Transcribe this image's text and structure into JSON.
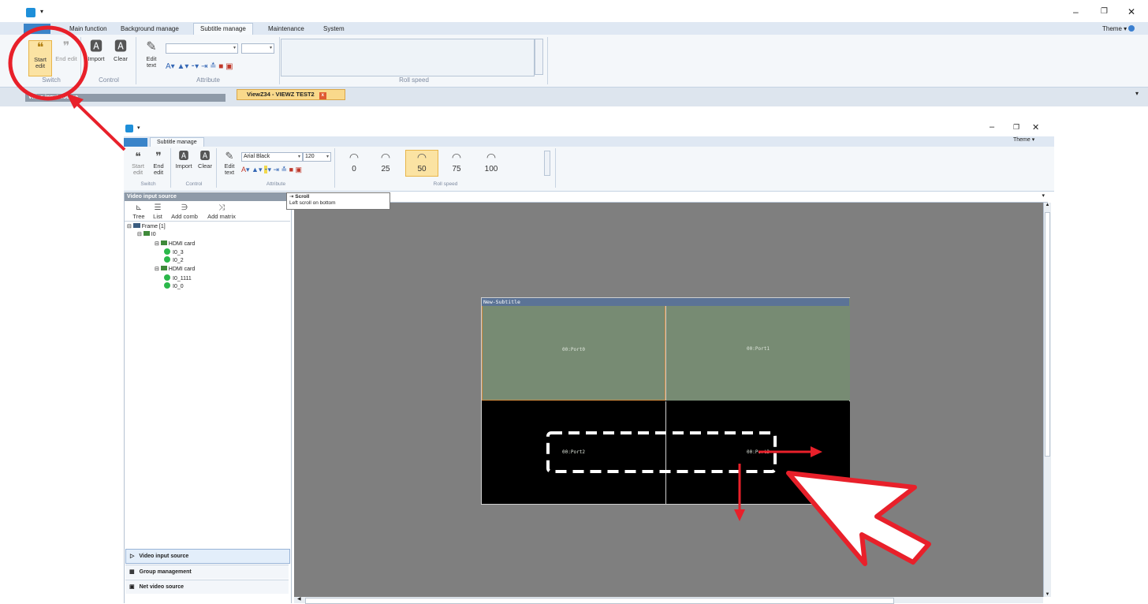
{
  "top_window": {
    "title_bar": {
      "minimize": "–",
      "restore": "❐",
      "close": "✕"
    },
    "tabs": [
      "Main function",
      "Background manage",
      "Subtitle manage",
      "Maintenance",
      "System"
    ],
    "active_tab": "Subtitle manage",
    "theme_label": "Theme",
    "ribbon": {
      "switch": {
        "start_edit": "Start edit",
        "end_edit": "End edit",
        "group_label": "Switch"
      },
      "control": {
        "import": "Import",
        "clear": "Clear",
        "group_label": "Control"
      },
      "attribute": {
        "edit_text": "Edit text",
        "group_label": "Attribute"
      },
      "roll_speed_label": "Roll speed"
    },
    "doc_tab": "ViewZ34 - VIEWZ TEST2",
    "doc_tab_close": "x",
    "left_panel_header": "Video input source"
  },
  "inner_window": {
    "title_bar": {
      "minimize": "–",
      "restore": "❐",
      "close": "✕"
    },
    "tabs": [
      "Subtitle manage"
    ],
    "theme_label": "Theme",
    "ribbon": {
      "switch": {
        "start_edit": "Start edit",
        "end_edit": "End edit",
        "group_label": "Switch"
      },
      "control": {
        "import": "Import",
        "clear": "Clear",
        "group_label": "Control"
      },
      "attribute": {
        "edit_text": "Edit text",
        "font": "Arial Black",
        "size": "120",
        "group_label": "Attribute"
      },
      "roll_speed": {
        "values": [
          "0",
          "25",
          "50",
          "75",
          "100"
        ],
        "selected": "50",
        "group_label": "Roll speed"
      }
    },
    "tooltip": {
      "title": "Scroll",
      "text": "Left scroll on bottom"
    },
    "panel": {
      "header": "Video input source",
      "toolbar": {
        "tree": "Tree",
        "list": "List",
        "add_comb": "Add comb",
        "add_matrix": "Add matrix"
      },
      "tree": {
        "frame": "Frame [1]",
        "node": "I0",
        "card1": "HDMI card",
        "card1_ports": [
          "I0_3",
          "I0_2"
        ],
        "card2": "HDMI card",
        "card2_ports": [
          "I0_1111",
          "I0_0"
        ]
      },
      "nav": [
        "Video input source",
        "Group management",
        "Net video source"
      ]
    },
    "canvas": {
      "subtitle_label": "New-Subtitle",
      "ports": [
        "00:Port0",
        "00:Port1",
        "00:Port2",
        "00:Port3"
      ]
    }
  },
  "colors": {
    "accent": "#e8202a",
    "highlight": "#fbe3a3",
    "canvas_bg": "#7f7f7f",
    "cell_green": "#778b73"
  }
}
